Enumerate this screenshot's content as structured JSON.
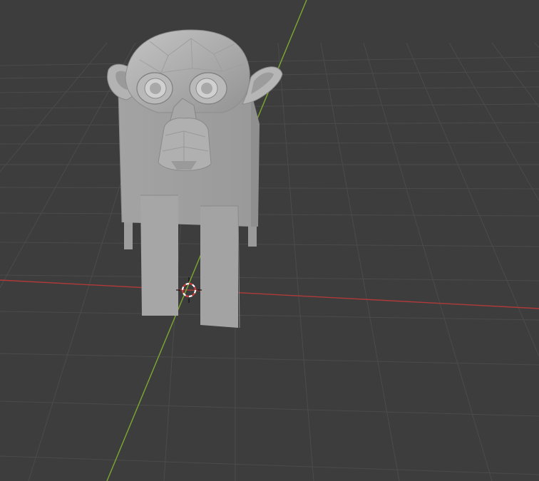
{
  "viewport": {
    "view_mode": "3d-viewport",
    "shading": "solid",
    "background_color": "#3d3d3d",
    "grid_color": "#4b4b4b",
    "x_axis_color": "#b03a3a",
    "y_axis_color": "#7da830"
  },
  "scene": {
    "objects": [
      {
        "name": "monkey-head",
        "icon": "suzanne-mesh-icon"
      },
      {
        "name": "body-block",
        "icon": "cube-mesh-icon"
      },
      {
        "name": "leg-front-left",
        "icon": "cube-mesh-icon"
      },
      {
        "name": "leg-front-right",
        "icon": "cube-mesh-icon"
      },
      {
        "name": "leg-back-left",
        "icon": "cube-mesh-icon"
      },
      {
        "name": "leg-back-right",
        "icon": "cube-mesh-icon"
      }
    ],
    "mesh_color": "#a9a9a9",
    "cursor": {
      "icon": "3d-cursor-icon",
      "colors": [
        "#d43c3c",
        "#ffffff"
      ]
    }
  }
}
